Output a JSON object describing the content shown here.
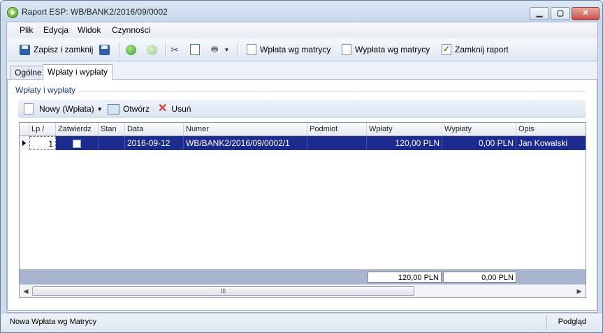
{
  "window": {
    "title": "Raport ESP: WB/BANK2/2016/09/0002"
  },
  "menu": [
    "Plik",
    "Edycja",
    "Widok",
    "Czynności"
  ],
  "toolbar": {
    "save_close": "Zapisz i zamknij",
    "wplata": "Wpłata wg matrycy",
    "wyplata": "Wypłata wg matrycy",
    "zamknij": "Zamknij raport"
  },
  "tabs": [
    "Ogólne",
    "Wpłaty i wypłaty"
  ],
  "group": {
    "label": "Wpłaty i wypłaty"
  },
  "gridbar": {
    "new": "Nowy (Wpłata)",
    "open": "Otwórz",
    "delete": "Usuń"
  },
  "grid": {
    "columns": [
      "Lp",
      "Zatwierdz",
      "Stan",
      "Data",
      "Numer",
      "Podmiot",
      "Wpłaty",
      "Wypłaty",
      "Opis"
    ],
    "rows": [
      {
        "lp": "1",
        "stan": "",
        "data": "2016-09-12",
        "numer": "WB/BANK2/2016/09/0002/1",
        "podmiot": "",
        "wplaty": "120,00 PLN",
        "wyplaty": "0,00 PLN",
        "opis": "Jan Kowalski"
      }
    ],
    "totals": {
      "wplaty": "120,00 PLN",
      "wyplaty": "0,00 PLN"
    },
    "scroll_thumb": "III"
  },
  "status": {
    "left": "Nowa Wpłata wg Matrycy",
    "right": "Podgląd"
  }
}
